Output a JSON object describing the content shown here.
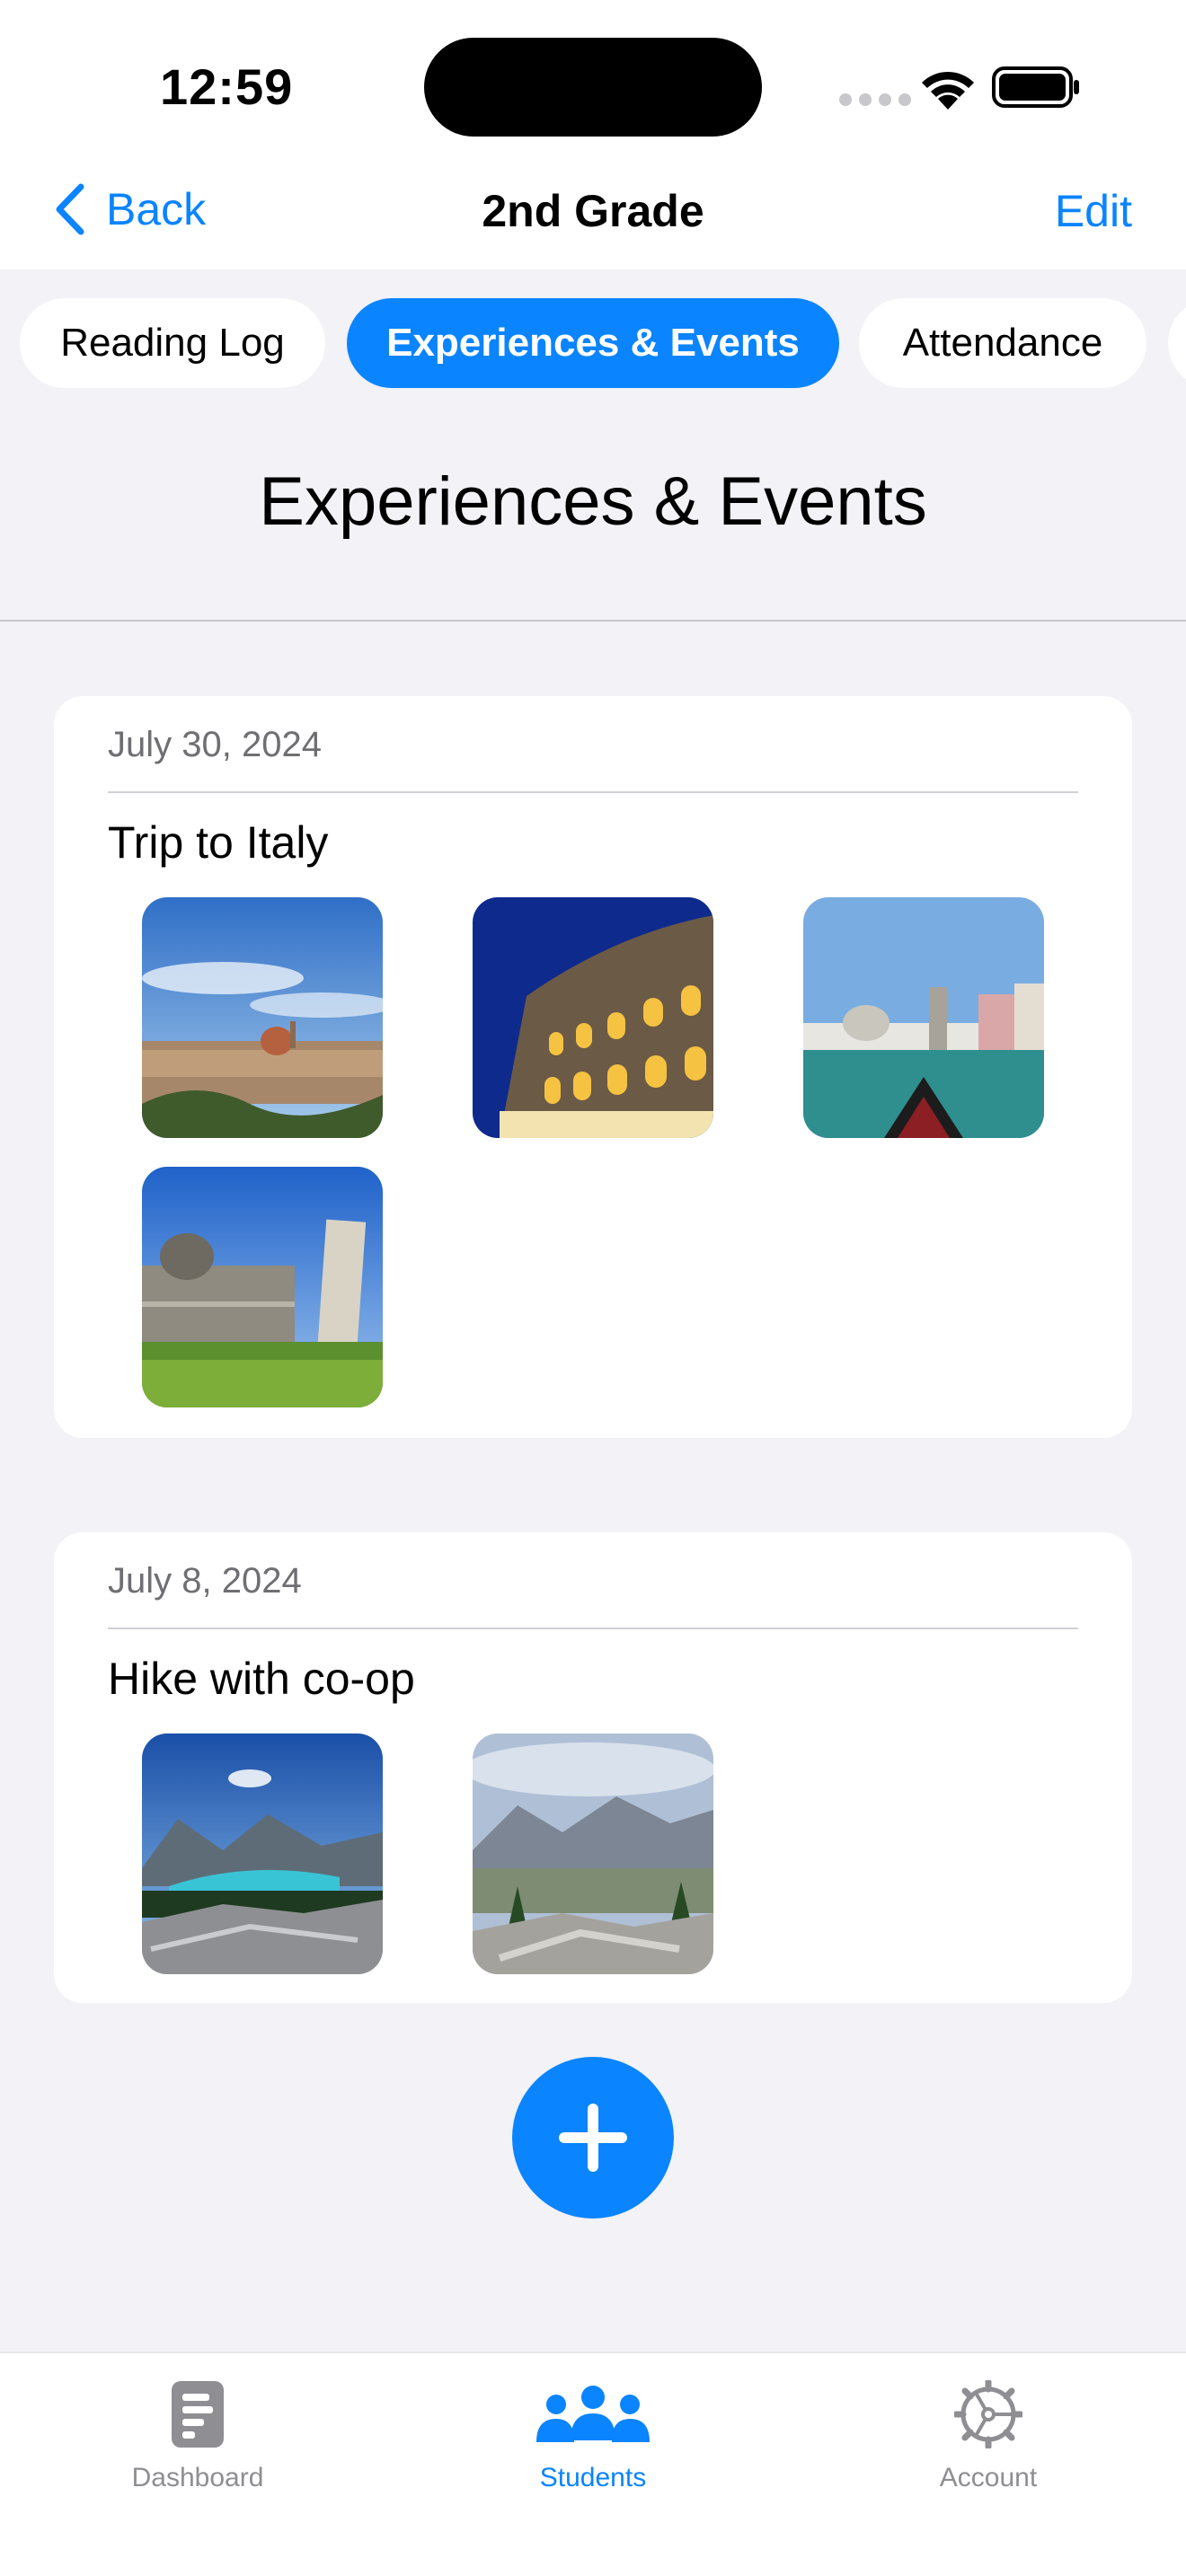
{
  "status_bar": {
    "time": "12:59"
  },
  "nav": {
    "back_label": "Back",
    "title": "2nd Grade",
    "edit_label": "Edit"
  },
  "segments": [
    {
      "label": "Reading Log",
      "active": false
    },
    {
      "label": "Experiences & Events",
      "active": true
    },
    {
      "label": "Attendance",
      "active": false
    }
  ],
  "page_heading": "Experiences & Events",
  "events": [
    {
      "date": "July 30, 2024",
      "title": "Trip to Italy",
      "photos": [
        "florence-skyline-photo",
        "colosseum-night-photo",
        "venice-gondola-photo",
        "pisa-tower-photo"
      ]
    },
    {
      "date": "July 8, 2024",
      "title": "Hike with co-op",
      "photos": [
        "mountain-lake-photo",
        "mountain-valley-photo"
      ]
    }
  ],
  "tabs": [
    {
      "label": "Dashboard",
      "icon": "dashboard-icon",
      "active": false
    },
    {
      "label": "Students",
      "icon": "students-icon",
      "active": true
    },
    {
      "label": "Account",
      "icon": "account-gear-icon",
      "active": false
    }
  ],
  "colors": {
    "accent": "#0A84FF",
    "background": "#F2F2F7",
    "inactive": "#8E8E93"
  }
}
